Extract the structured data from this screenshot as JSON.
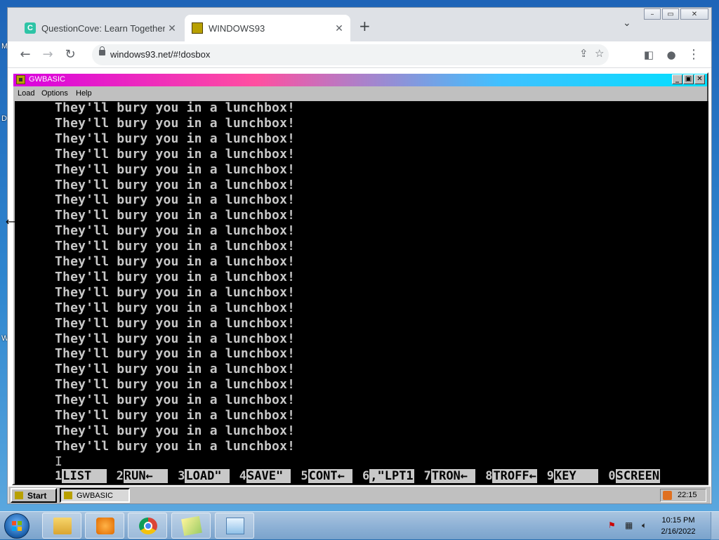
{
  "desktop": {
    "side_letters": [
      "M",
      "D",
      "W"
    ]
  },
  "browser": {
    "tabs": [
      {
        "label": "QuestionCove: Learn Together",
        "favicon": "C"
      },
      {
        "label": "WINDOWS93"
      }
    ],
    "url": "windows93.net/#!dosbox"
  },
  "gwbasic": {
    "title": "GWBASIC",
    "menu": [
      "Load",
      "Options",
      "Help"
    ],
    "output_lines": [
      "They'll bury you in a lunchbox!",
      "They'll bury you in a lunchbox!",
      "They'll bury you in a lunchbox!",
      "They'll bury you in a lunchbox!",
      "They'll bury you in a lunchbox!",
      "They'll bury you in a lunchbox!",
      "They'll bury you in a lunchbox!",
      "They'll bury you in a lunchbox!",
      "They'll bury you in a lunchbox!",
      "They'll bury you in a lunchbox!",
      "They'll bury you in a lunchbox!",
      "They'll bury you in a lunchbox!",
      "They'll bury you in a lunchbox!",
      "They'll bury you in a lunchbox!",
      "They'll bury you in a lunchbox!",
      "They'll bury you in a lunchbox!",
      "They'll bury you in a lunchbox!",
      "They'll bury you in a lunchbox!",
      "They'll bury you in a lunchbox!",
      "They'll bury you in a lunchbox!",
      "They'll bury you in a lunchbox!",
      "They'll bury you in a lunchbox!",
      "They'll bury you in a lunchbox!"
    ],
    "cursor": "I",
    "function_keys": [
      {
        "num": "1",
        "cmd": "LIST  "
      },
      {
        "num": "2",
        "cmd": "RUN←  "
      },
      {
        "num": "3",
        "cmd": "LOAD\" "
      },
      {
        "num": "4",
        "cmd": "SAVE\" "
      },
      {
        "num": "5",
        "cmd": "CONT← "
      },
      {
        "num": "6",
        "cmd": ",\"LPT1"
      },
      {
        "num": "7",
        "cmd": "TRON← "
      },
      {
        "num": "8",
        "cmd": "TROFF←"
      },
      {
        "num": "9",
        "cmd": "KEY   "
      },
      {
        "num": "0",
        "cmd": "SCREEN"
      }
    ]
  },
  "w93_taskbar": {
    "start_label": "Start",
    "task_label": "GWBASIC",
    "clock": "22:15"
  },
  "win7_taskbar": {
    "time": "10:15 PM",
    "date": "2/16/2022",
    "pinned_icons": [
      "explorer-icon",
      "media-player-icon",
      "chrome-icon",
      "folder-icon",
      "notepad-icon"
    ]
  },
  "colors": {
    "terminal_fg": "#c8c8c8",
    "terminal_bg": "#000000",
    "w93_title_gradient": [
      "#d800e0",
      "#00e0ff"
    ]
  }
}
